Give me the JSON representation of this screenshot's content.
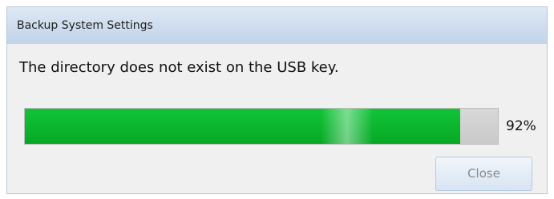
{
  "dialog": {
    "title": "Backup System Settings",
    "message": "The directory does not exist on the USB key.",
    "progress": {
      "value": 0.92,
      "label": "92%",
      "fill_color": "#0cb82f"
    },
    "close_label": "Close",
    "close_enabled": false
  }
}
